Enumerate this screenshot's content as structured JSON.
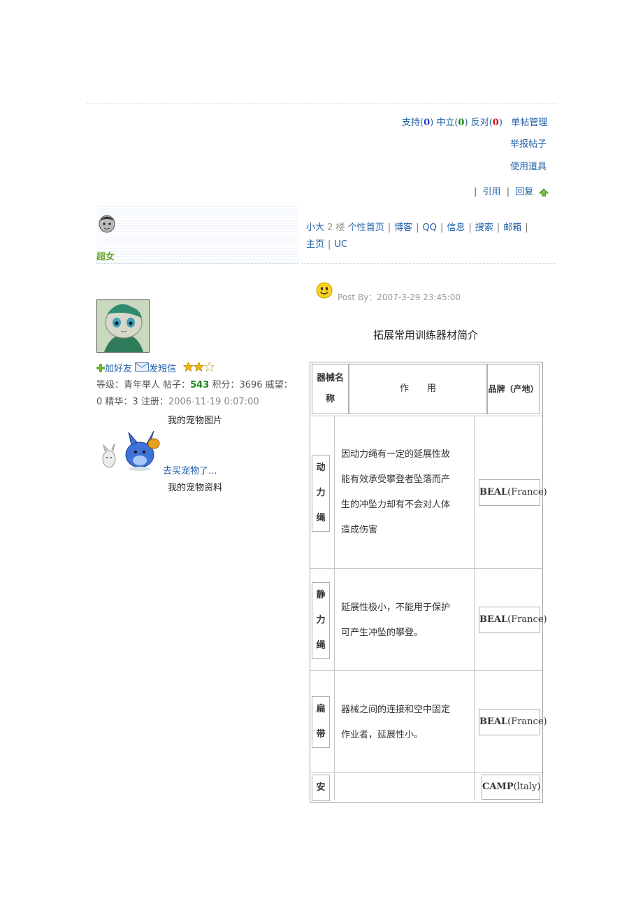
{
  "vote": {
    "support_label": "支持(",
    "support_count": "0",
    "neutral_label": "中立(",
    "neutral_count": "0",
    "oppose_label": "反对(",
    "oppose_count": "0",
    "close_paren": ")",
    "manage_label": "单帖管理"
  },
  "report_label": "举报帖子",
  "props_label": "使用道具",
  "post_actions": {
    "sep": "|",
    "quote_label": "引用",
    "reply_label": "回复"
  },
  "user": {
    "name": "超女",
    "nav": {
      "size_label": "小大",
      "floor": "2 楼",
      "items": [
        "个性首页",
        "博客",
        "QQ",
        "信息",
        "搜索",
        "邮箱",
        "主页",
        "UC"
      ]
    },
    "add_friend": "加好友",
    "send_msg": "发短信",
    "stats_line1_a": "等级：青年举人  帖子：",
    "posts": "543",
    "stats_line1_b": "  积分：3696  威望：",
    "stats_line2_a": "0  精华：3  注册：",
    "register_date": "2006-11-19  0:07:00",
    "pet_title": "我的宠物图片",
    "pet_link": "去买宠物了...",
    "pet_data": "我的宠物资料"
  },
  "post": {
    "postby": "Post  By：2007-3-29  23:45:00",
    "title": "拓展常用训练器材简介"
  },
  "table": {
    "headers": {
      "name": "器械名称",
      "name_line1": "器械名",
      "name_line2": "称",
      "use": "作　　用",
      "brand": "品牌（产地）"
    },
    "rows": [
      {
        "name": [
          "动",
          "力",
          "绳"
        ],
        "desc": [
          "因动力绳有一定的延展性故",
          "能有效承受攀登者坠落而产",
          "生的冲坠力却有不会对人体",
          "造成伤害"
        ],
        "brand_bold": "BEAL",
        "brand_rest": "(France)"
      },
      {
        "name": [
          "静",
          "力",
          "绳"
        ],
        "desc": [
          "延展性极小，不能用于保护",
          "可产生冲坠的攀登。"
        ],
        "brand_bold": "BEAL",
        "brand_rest": "(France)"
      },
      {
        "name": [
          "扁",
          "带"
        ],
        "desc": [
          "器械之间的连接和空中固定",
          "作业者，延展性小。"
        ],
        "brand_bold": "BEAL",
        "brand_rest": "(France)"
      },
      {
        "name": [
          "安"
        ],
        "desc": [],
        "brand_bold": "CAMP",
        "brand_rest": "(ltaly)"
      }
    ]
  }
}
